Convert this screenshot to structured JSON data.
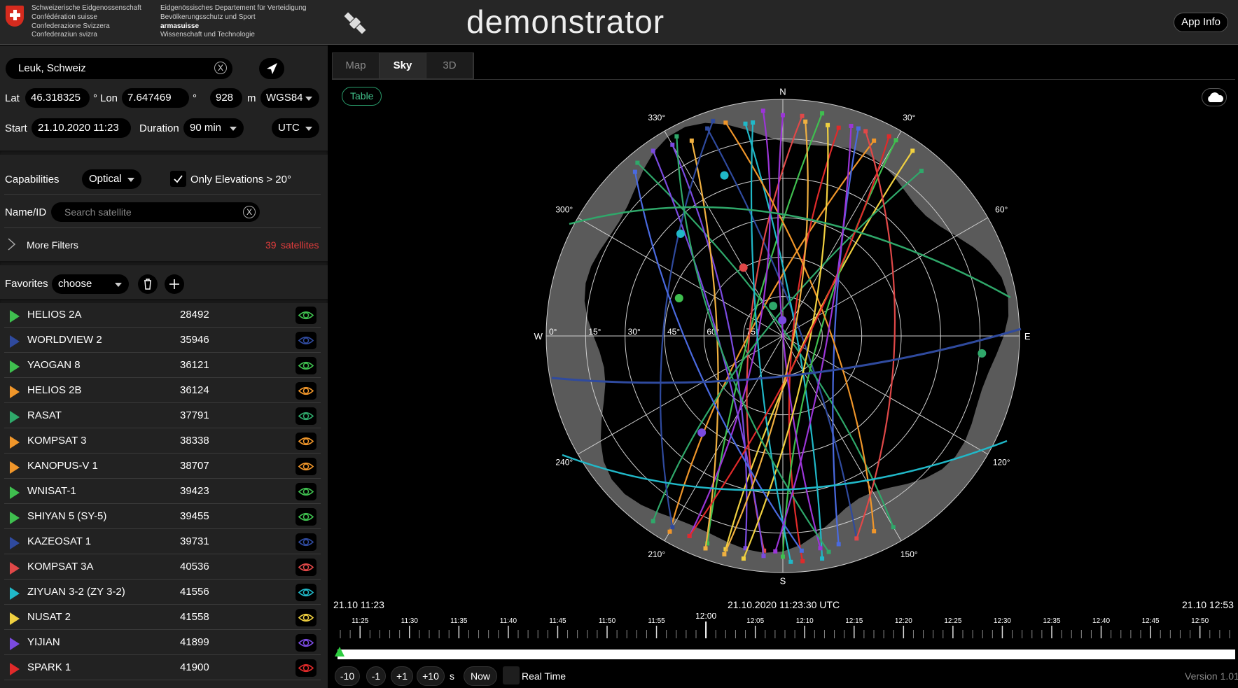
{
  "header": {
    "confederation": [
      "Schweizerische Eidgenossenschaft",
      "Confédération suisse",
      "Confederazione Svizzera",
      "Confederaziun svizra"
    ],
    "department": [
      "Eidgenössisches Departement für Verteidigung",
      "Bevölkerungsschutz und Sport"
    ],
    "department_unit": "armasuisse",
    "department_unit_sub": "Wissenschaft und Technologie",
    "app_title": "demonstrator",
    "app_info_label": "App Info",
    "logo_icon": "satellite-icon"
  },
  "location": {
    "value": "Leuk, Schweiz",
    "clear_label": "X",
    "locate_icon": "navigation-arrow-icon"
  },
  "coords": {
    "lat_label": "Lat",
    "lat_value": "46.318325",
    "lat_unit": "°",
    "lon_label": "Lon",
    "lon_value": "7.647469",
    "lon_unit": "°",
    "alt_value": "928",
    "alt_unit": "m",
    "datum": "WGS84"
  },
  "time": {
    "start_label": "Start",
    "start_value": "21.10.2020  11:23",
    "duration_label": "Duration",
    "duration_value": "90 min",
    "timezone": "UTC"
  },
  "filters": {
    "capabilities_label": "Capabilities",
    "capabilities_value": "Optical",
    "elevation_label": "Only Elevations > 20°",
    "elevation_checked": true,
    "name_label": "Name/ID",
    "search_placeholder": "Search satellite",
    "clear_label": "X",
    "more_filters_label": "More Filters",
    "satellite_count": "39",
    "satellite_count_label": "satellites"
  },
  "favorites": {
    "label": "Favorites",
    "value": "choose"
  },
  "satellites": [
    {
      "name": "HELIOS 2A",
      "id": "28492",
      "color": "#3fbf4f"
    },
    {
      "name": "WORLDVIEW 2",
      "id": "35946",
      "color": "#2f4a9e"
    },
    {
      "name": "YAOGAN 8",
      "id": "36121",
      "color": "#3fbf4f"
    },
    {
      "name": "HELIOS 2B",
      "id": "36124",
      "color": "#f0962a"
    },
    {
      "name": "RASAT",
      "id": "37791",
      "color": "#2fa86a"
    },
    {
      "name": "KOMPSAT 3",
      "id": "38338",
      "color": "#f0962a"
    },
    {
      "name": "KANOPUS-V 1",
      "id": "38707",
      "color": "#f0962a"
    },
    {
      "name": "WNISAT-1",
      "id": "39423",
      "color": "#3fbf4f"
    },
    {
      "name": "SHIYAN 5 (SY-5)",
      "id": "39455",
      "color": "#3fbf4f"
    },
    {
      "name": "KAZEOSAT 1",
      "id": "39731",
      "color": "#2f4a9e"
    },
    {
      "name": "KOMPSAT 3A",
      "id": "40536",
      "color": "#e04848"
    },
    {
      "name": "ZIYUAN 3-2 (ZY 3-2)",
      "id": "41556",
      "color": "#20b8c8"
    },
    {
      "name": "NUSAT 2",
      "id": "41558",
      "color": "#f0d040"
    },
    {
      "name": "YIJIAN",
      "id": "41899",
      "color": "#7a4ae0"
    },
    {
      "name": "SPARK 1",
      "id": "41900",
      "color": "#e02a2a"
    }
  ],
  "tabs": [
    "Map",
    "Sky",
    "3D"
  ],
  "active_tab": "Sky",
  "sky": {
    "table_label": "Table",
    "cloud_icon": "cloud-icon",
    "directions": {
      "N": "N",
      "E": "E",
      "S": "S",
      "W": "W"
    },
    "azimuth_labels": [
      "30°",
      "60°",
      "120°",
      "150°",
      "210°",
      "240°",
      "300°",
      "330°"
    ],
    "elevation_labels": [
      "0°",
      "15°",
      "30°",
      "45°",
      "60°",
      "75°"
    ]
  },
  "timeline": {
    "start_label": "21.10 11:23",
    "current_label": "21.10.2020 11:23:30 UTC",
    "end_label": "21.10 12:53",
    "hour_label": "12:00",
    "tick_labels": [
      "11:25",
      "11:30",
      "11:35",
      "11:40",
      "11:45",
      "11:50",
      "11:55",
      "12:05",
      "12:10",
      "12:15",
      "12:20",
      "12:25",
      "12:30",
      "12:35",
      "12:40",
      "12:45",
      "12:50"
    ],
    "buttons": [
      "-10",
      "-1",
      "+1",
      "+10"
    ],
    "unit": "s",
    "now_label": "Now",
    "realtime_label": "Real Time",
    "version": "Version 1.01"
  }
}
